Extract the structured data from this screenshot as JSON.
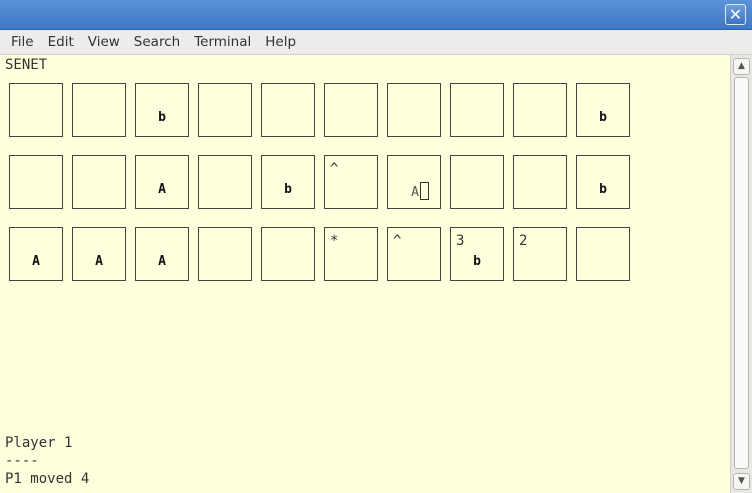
{
  "window": {
    "close_glyph": "✕"
  },
  "menu": [
    "File",
    "Edit",
    "View",
    "Search",
    "Terminal",
    "Help"
  ],
  "terminal": {
    "title": "SENET",
    "board": [
      [
        {
          "mark": "",
          "piece": ""
        },
        {
          "mark": "",
          "piece": ""
        },
        {
          "mark": "",
          "piece": "b"
        },
        {
          "mark": "",
          "piece": ""
        },
        {
          "mark": "",
          "piece": ""
        },
        {
          "mark": "",
          "piece": ""
        },
        {
          "mark": "",
          "piece": ""
        },
        {
          "mark": "",
          "piece": ""
        },
        {
          "mark": "",
          "piece": ""
        },
        {
          "mark": "",
          "piece": "b"
        }
      ],
      [
        {
          "mark": "",
          "piece": ""
        },
        {
          "mark": "",
          "piece": ""
        },
        {
          "mark": "",
          "piece": "A"
        },
        {
          "mark": "",
          "piece": ""
        },
        {
          "mark": "",
          "piece": "b"
        },
        {
          "mark": "^",
          "piece": ""
        },
        {
          "mark": "",
          "piece": "A",
          "cursor": true
        },
        {
          "mark": "",
          "piece": ""
        },
        {
          "mark": "",
          "piece": ""
        },
        {
          "mark": "",
          "piece": "b"
        }
      ],
      [
        {
          "mark": "",
          "piece": "A"
        },
        {
          "mark": "",
          "piece": "A"
        },
        {
          "mark": "",
          "piece": "A"
        },
        {
          "mark": "",
          "piece": ""
        },
        {
          "mark": "",
          "piece": ""
        },
        {
          "mark": "*",
          "piece": ""
        },
        {
          "mark": "^",
          "piece": ""
        },
        {
          "mark": "3",
          "piece": "b"
        },
        {
          "mark": "2",
          "piece": ""
        },
        {
          "mark": "",
          "piece": ""
        }
      ]
    ],
    "status": {
      "player": "Player 1",
      "separator": "----",
      "last_move": "P1 moved 4"
    }
  },
  "scrollbar": {
    "up_glyph": "▲",
    "down_glyph": "▼"
  }
}
